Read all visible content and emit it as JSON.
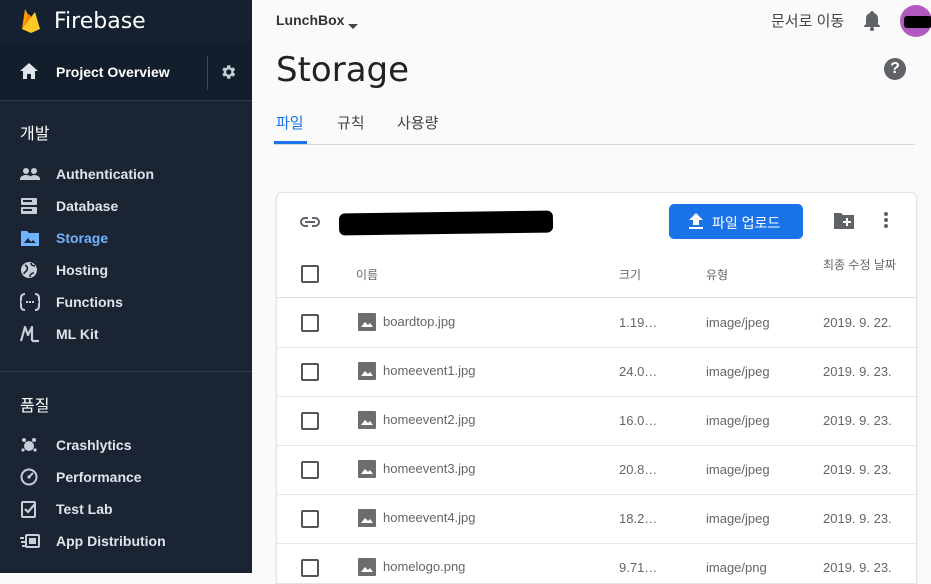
{
  "sidebar": {
    "brand": "Firebase",
    "overview_label": "Project Overview",
    "section_dev": "개발",
    "section_quality": "품질",
    "dev_items": [
      {
        "label": "Authentication",
        "icon": "people-icon"
      },
      {
        "label": "Database",
        "icon": "database-icon"
      },
      {
        "label": "Storage",
        "icon": "storage-icon"
      },
      {
        "label": "Hosting",
        "icon": "globe-icon"
      },
      {
        "label": "Functions",
        "icon": "functions-icon"
      },
      {
        "label": "ML Kit",
        "icon": "ml-kit-icon"
      }
    ],
    "quality_items": [
      {
        "label": "Crashlytics",
        "icon": "crashlytics-icon"
      },
      {
        "label": "Performance",
        "icon": "performance-icon"
      },
      {
        "label": "Test Lab",
        "icon": "test-lab-icon"
      },
      {
        "label": "App Distribution",
        "icon": "app-distribution-icon"
      }
    ],
    "active_item": "Storage"
  },
  "header": {
    "project_name": "LunchBox",
    "docs_link": "문서로 이동",
    "page_title": "Storage"
  },
  "tabs": [
    "파일",
    "규칙",
    "사용량"
  ],
  "toolbar": {
    "upload_label": "파일 업로드"
  },
  "table": {
    "columns": [
      "이름",
      "크기",
      "유형",
      "최종 수정 날짜"
    ],
    "rows": [
      {
        "name": "boardtop.jpg",
        "size": "1.19…",
        "type": "image/jpeg",
        "date": "2019. 9. 22."
      },
      {
        "name": "homeevent1.jpg",
        "size": "24.0…",
        "type": "image/jpeg",
        "date": "2019. 9. 23."
      },
      {
        "name": "homeevent2.jpg",
        "size": "16.0…",
        "type": "image/jpeg",
        "date": "2019. 9. 23."
      },
      {
        "name": "homeevent3.jpg",
        "size": "20.8…",
        "type": "image/jpeg",
        "date": "2019. 9. 23."
      },
      {
        "name": "homeevent4.jpg",
        "size": "18.2…",
        "type": "image/jpeg",
        "date": "2019. 9. 23."
      },
      {
        "name": "homelogo.png",
        "size": "9.71…",
        "type": "image/png",
        "date": "2019. 9. 23."
      }
    ]
  },
  "colors": {
    "sidebar_bg": "#1a2433",
    "accent": "#1a73e8",
    "active_nav": "#6fb3ff",
    "firebase_orange": "#f6a623"
  }
}
